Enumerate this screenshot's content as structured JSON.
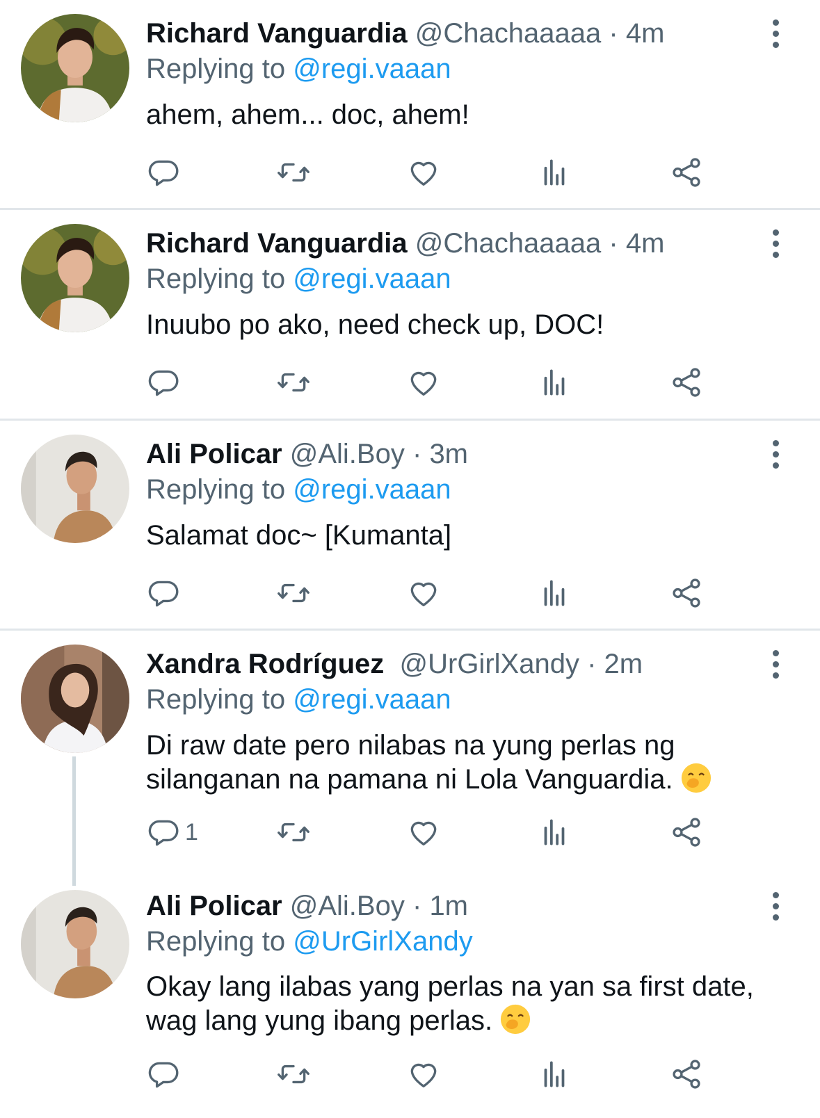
{
  "tweets": [
    {
      "name": "Richard Vanguardia",
      "handle": "@Chachaaaaa",
      "separator": "·",
      "time": "4m",
      "replying_label": "Replying to",
      "replying_to": "@regi.vaaan",
      "text": "ahem, ahem... doc, ahem!",
      "reply_count": ""
    },
    {
      "name": "Richard Vanguardia",
      "handle": "@Chachaaaaa",
      "separator": "·",
      "time": "4m",
      "replying_label": "Replying to",
      "replying_to": "@regi.vaaan",
      "text": "Inuubo po ako, need check up, DOC!",
      "reply_count": ""
    },
    {
      "name": "Ali Policar",
      "handle": "@Ali.Boy",
      "separator": "·",
      "time": "3m",
      "replying_label": "Replying to",
      "replying_to": "@regi.vaaan",
      "text": "Salamat doc~ [Kumanta]",
      "reply_count": ""
    },
    {
      "name": "Xandra Rodríguez",
      "handle": "@UrGirlXandy",
      "separator": "·",
      "time": "2m",
      "replying_label": "Replying to",
      "replying_to": "@regi.vaaan",
      "text_line1": "Di raw date pero nilabas na yung perlas ng",
      "text_line2": "silanganan na pamana ni Lola Vanguardia.",
      "emoji": "face-with-hand-over-mouth-emoji",
      "reply_count": "1"
    },
    {
      "name": "Ali Policar",
      "handle": "@Ali.Boy",
      "separator": "·",
      "time": "1m",
      "replying_label": "Replying to",
      "replying_to": "@UrGirlXandy",
      "text_line1": "Okay lang ilabas yang perlas na yan sa first date,",
      "text_line2": "wag lang yung ibang perlas.",
      "emoji": "face-with-hand-over-mouth-emoji",
      "reply_count": ""
    }
  ],
  "icons": {
    "reply": "reply-icon",
    "retweet": "retweet-icon",
    "like": "like-icon",
    "views": "views-icon",
    "share": "share-icon",
    "more": "more-options-icon"
  },
  "colors": {
    "text": "#0f1419",
    "secondary": "#536471",
    "mention": "#1d9bf0",
    "divider": "#e1e6ea",
    "thread_line": "#cfd9de"
  }
}
